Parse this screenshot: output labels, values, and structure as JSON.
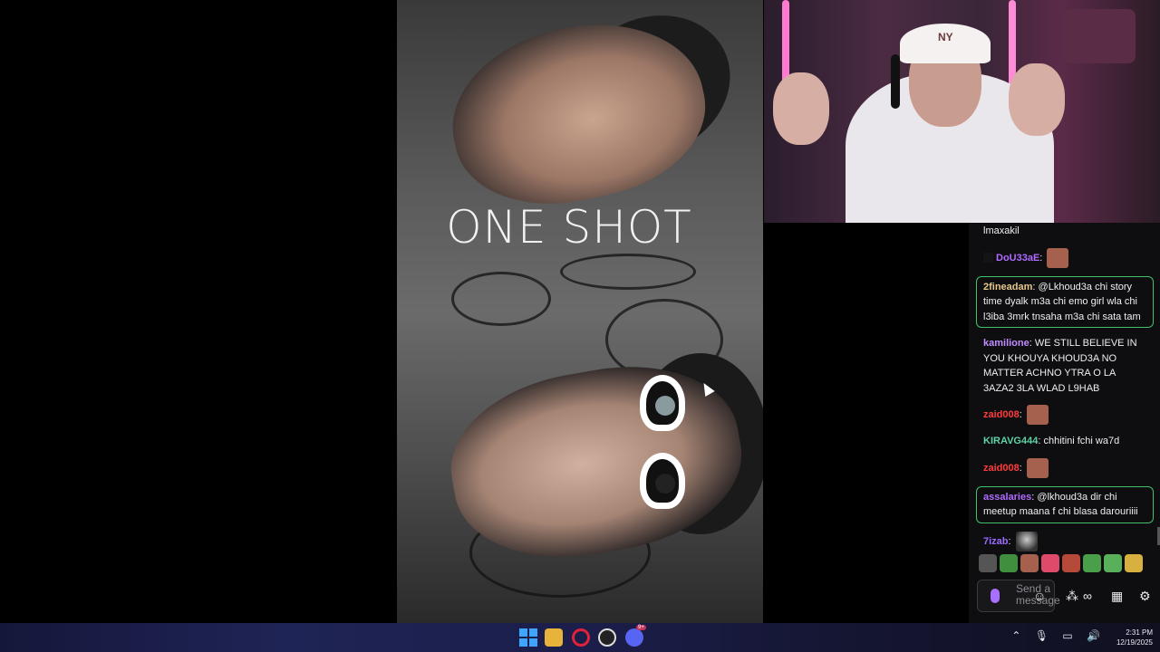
{
  "video": {
    "overlay_title": "ONE SHOT"
  },
  "webcam": {
    "cap_text": "NY"
  },
  "chat": {
    "messages": [
      {
        "user": "",
        "text": "lmaxakil",
        "user_color": "#efeff1",
        "highlight": false,
        "emote": false,
        "badge": false
      },
      {
        "user": "DoU33aE",
        "text": "",
        "user_color": "#b06bff",
        "highlight": false,
        "emote": true,
        "badge": true
      },
      {
        "user": "2fineadam",
        "text": "@Lkhoud3a chi story time dyalk m3a chi emo girl wla chi l3iba 3mrk tnsaha m3a chi sata tam",
        "user_color": "#e6c88a",
        "highlight": true,
        "emote": false,
        "badge": false
      },
      {
        "user": "kamilione",
        "text": "WE STILL BELIEVE IN YOU KHOUYA KHOUD3A NO MATTER ACHNO YTRA O LA 3AZA2 3LA WLAD L9HAB",
        "user_color": "#c08cff",
        "highlight": false,
        "emote": false,
        "badge": false
      },
      {
        "user": "zaid008",
        "text": "",
        "user_color": "#ff3b3b",
        "highlight": false,
        "emote": true,
        "badge": false
      },
      {
        "user": "KIRAVG444",
        "text": "chhitini fchi wa7d",
        "user_color": "#5fd3a6",
        "highlight": false,
        "emote": false,
        "badge": false
      },
      {
        "user": "zaid008",
        "text": "",
        "user_color": "#ff3b3b",
        "highlight": false,
        "emote": true,
        "badge": false
      },
      {
        "user": "assalaries",
        "text": "@lkhoud3a dir chi meetup maana f chi blasa darouriiii",
        "user_color": "#b06bff",
        "highlight": true,
        "emote": false,
        "badge": false
      },
      {
        "user": "7izab",
        "text": "",
        "user_color": "#9a6bff",
        "highlight": false,
        "emote": true,
        "badge": false,
        "emote_style": "bot"
      }
    ],
    "emote_colors": [
      "#555",
      "#3f8f3f",
      "#a6604e",
      "#e04a6a",
      "#b54a3a",
      "#4aa04a",
      "#5ab05a",
      "#d8b040"
    ],
    "input_placeholder": "Send a message",
    "icons": [
      "emote-picker-icon",
      "bits-icon",
      "infinity-icon",
      "store-icon",
      "settings-icon"
    ]
  },
  "taskbar": {
    "apps": [
      "windows-start-icon",
      "file-explorer-icon",
      "opera-icon",
      "obs-icon",
      "discord-icon"
    ],
    "discord_badge": "9+",
    "time": "2:31 PM",
    "date": "12/19/2025",
    "tray_icons": [
      "chevron-up-icon",
      "microphone-icon",
      "display-icon",
      "speaker-icon"
    ]
  }
}
